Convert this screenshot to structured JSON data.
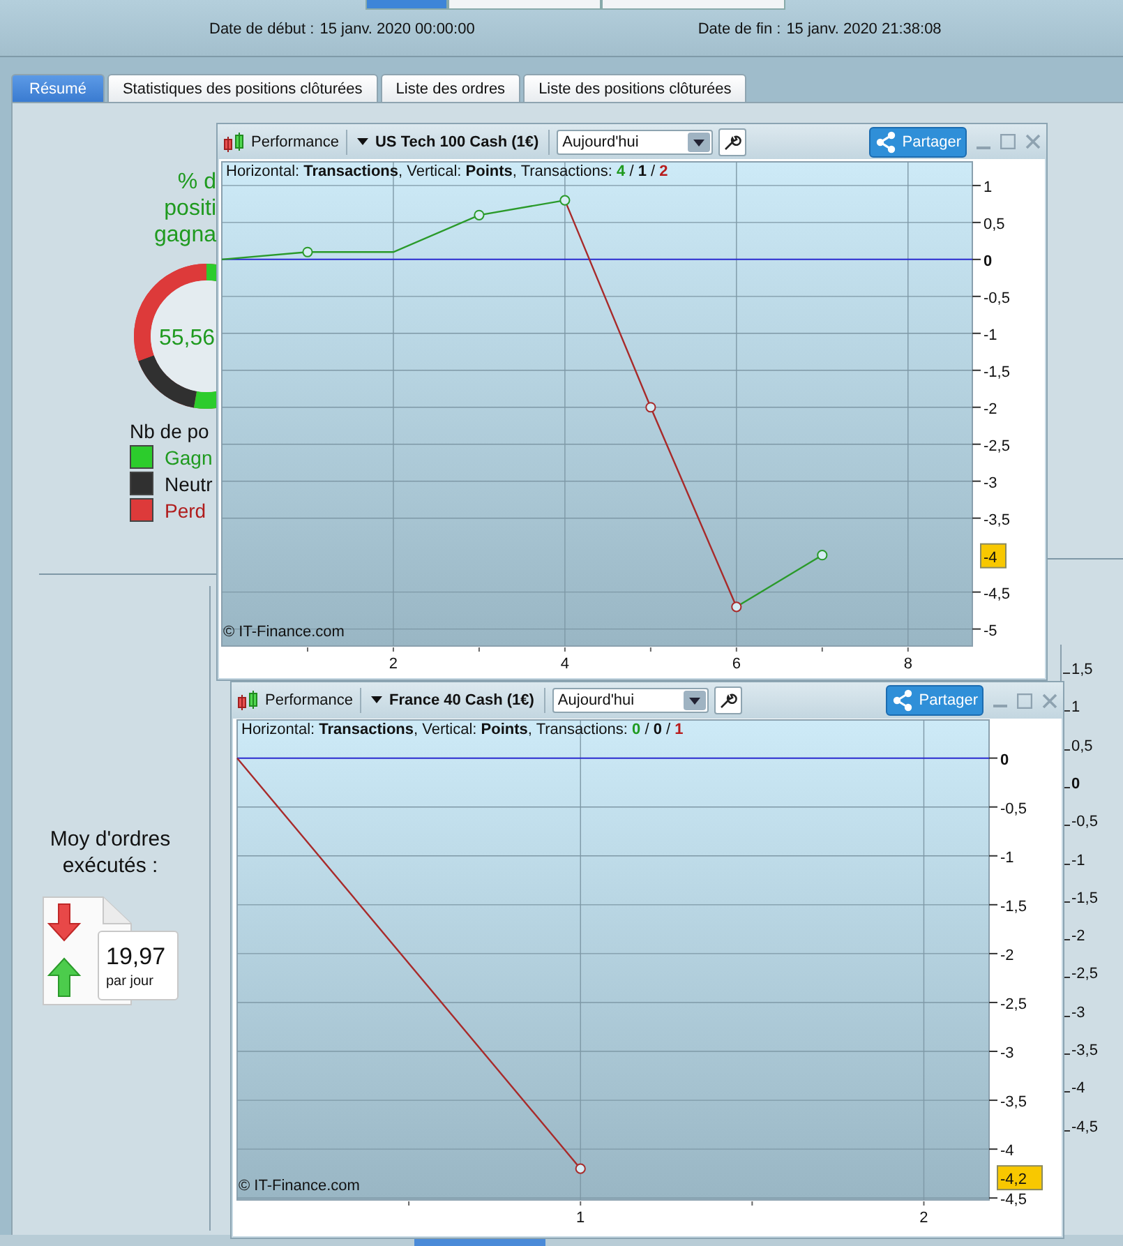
{
  "top_segments": [
    {
      "selected": true
    },
    {
      "selected": false
    },
    {
      "selected": false
    }
  ],
  "date_start": {
    "label": "Date de début :",
    "value": "15 janv. 2020 00:00:00"
  },
  "date_end": {
    "label": "Date de fin :",
    "value": "15 janv. 2020 21:38:08"
  },
  "tabs": [
    {
      "label": "Résumé",
      "selected": true
    },
    {
      "label": "Statistiques des positions clôturées",
      "selected": false
    },
    {
      "label": "Liste des ordres",
      "selected": false
    },
    {
      "label": "Liste des positions clôturées",
      "selected": false
    }
  ],
  "summary": {
    "title_lines": [
      "% d",
      "positi",
      "gagna"
    ],
    "donut_value": "55,56",
    "legend_title": "Nb de po",
    "legend": [
      {
        "label": "Gagn",
        "color": "#2ccc2c"
      },
      {
        "label": "Neutr",
        "color": "#303030"
      },
      {
        "label": "Perd",
        "color": "#dd3a3a"
      }
    ],
    "orders_label_lines": [
      "Moy d'ordres",
      "exécutés :"
    ],
    "orders_value": "19,97",
    "orders_unit": "par jour"
  },
  "background_axis": {
    "ticks": [
      {
        "label": "1,5",
        "bold": false
      },
      {
        "label": "1",
        "bold": false
      },
      {
        "label": "0,5",
        "bold": false
      },
      {
        "label": "0",
        "bold": true
      },
      {
        "label": "-0,5",
        "bold": false
      },
      {
        "label": "-1",
        "bold": false
      },
      {
        "label": "-1,5",
        "bold": false
      },
      {
        "label": "-2",
        "bold": false
      },
      {
        "label": "-2,5",
        "bold": false
      },
      {
        "label": "-3",
        "bold": false
      },
      {
        "label": "-3,5",
        "bold": false
      },
      {
        "label": "-4",
        "bold": false
      },
      {
        "label": "-4,5",
        "bold": false
      }
    ]
  },
  "windows": [
    {
      "title": "Performance",
      "instrument": "US Tech 100 Cash (1€)",
      "period": "Aujourd'hui",
      "share": "Partager",
      "legend": "Horizontal: **Transactions**, Vertical: **Points**, Transactions: ",
      "count_separator": " / ",
      "counts": [
        {
          "value": "4",
          "color": "#1f9a1f"
        },
        {
          "value": "1",
          "color": "#111111"
        },
        {
          "value": "2",
          "color": "#b81c1c"
        }
      ],
      "watermark": "© IT-Finance.com",
      "last_value": "-4",
      "chart_data": {
        "type": "line",
        "x": [
          0,
          1,
          2,
          3,
          4,
          5,
          6,
          7
        ],
        "series": [
          {
            "color": "#2a9a2a",
            "values": [
              0,
              0.1,
              0.1,
              0.6,
              0.8,
              null,
              -4.7,
              -4
            ]
          },
          {
            "color": "#a82a2a",
            "values": [
              null,
              null,
              null,
              null,
              0.8,
              -2,
              -4.7,
              null
            ]
          }
        ],
        "grid": true,
        "ref_lines": [
          {
            "axis": "y",
            "value": 0,
            "color": "#2a2ad0"
          }
        ],
        "xlim": [
          0,
          8.75
        ],
        "ylim": [
          -5.23,
          1.32
        ],
        "xticks": [
          2,
          4,
          6,
          8
        ],
        "yticks": [
          1,
          {
            "value": 0.5,
            "label": "0,5"
          },
          0,
          {
            "value": -0.5,
            "label": "-0,5"
          },
          -1,
          {
            "value": -1.5,
            "label": "-1,5"
          },
          -2,
          {
            "value": -2.5,
            "label": "-2,5"
          },
          -3,
          {
            "value": -3.5,
            "label": "-3,5"
          },
          {
            "value": -4.5,
            "label": "-4,5"
          },
          -5
        ]
      }
    },
    {
      "title": "Performance",
      "instrument": "France 40 Cash (1€)",
      "period": "Aujourd'hui",
      "share": "Partager",
      "legend": "Horizontal: **Transactions**, Vertical: **Points**, Transactions: ",
      "count_separator": " / ",
      "counts": [
        {
          "value": "0",
          "color": "#1f9a1f"
        },
        {
          "value": "0",
          "color": "#111111"
        },
        {
          "value": "1",
          "color": "#b81c1c"
        }
      ],
      "watermark": "© IT-Finance.com",
      "last_value": "-4,2",
      "chart_data": {
        "type": "line",
        "x": [
          0,
          1
        ],
        "series": [
          {
            "color": "#a82a2a",
            "values": [
              0,
              -4.2
            ]
          }
        ],
        "grid": true,
        "ref_lines": [
          {
            "axis": "y",
            "value": 0,
            "color": "#2a2ad0"
          }
        ],
        "xlim": [
          0,
          2.19
        ],
        "ylim": [
          -4.52,
          0.39
        ],
        "xticks": [
          1,
          2
        ],
        "yticks": [
          0,
          {
            "value": -0.5,
            "label": "-0,5"
          },
          -1,
          {
            "value": -1.5,
            "label": "-1,5"
          },
          -2,
          {
            "value": -2.5,
            "label": "-2,5"
          },
          -3,
          {
            "value": -3.5,
            "label": "-3,5"
          },
          -4,
          {
            "value": -4.5,
            "label": "-4,5"
          }
        ]
      }
    }
  ]
}
